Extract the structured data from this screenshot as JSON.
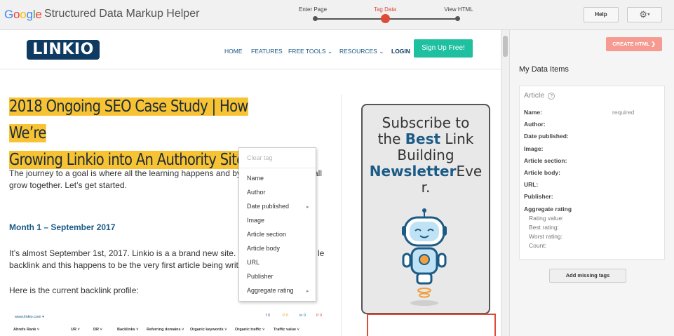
{
  "app": {
    "brand": "Google",
    "title": "Structured Data Markup Helper",
    "brand_colors": [
      "#4285f4",
      "#ea4335",
      "#fbbc05",
      "#4285f4",
      "#34a853",
      "#ea4335"
    ]
  },
  "steps": [
    {
      "label": "Enter Page",
      "active": false
    },
    {
      "label": "Tag Data",
      "active": true
    },
    {
      "label": "View HTML",
      "active": false
    }
  ],
  "toolbar": {
    "help_label": "Help",
    "gear_icon": "gear-icon",
    "caret": "▾"
  },
  "site": {
    "logo_text": "LINKIO",
    "nav": [
      {
        "label": "HOME"
      },
      {
        "label": "FEATURES"
      },
      {
        "label": "FREE TOOLS ⌄"
      },
      {
        "label": "RESOURCES ⌄"
      },
      {
        "label": "LOGIN"
      }
    ],
    "signup_label": "Sign Up Free!",
    "article": {
      "title_line1": "2018 Ongoing SEO Case Study | How We’re",
      "title_line2": "Growing Linkio into An Authority Site",
      "intro_line1": "The journey to a goal is where all the learning happens and by sh",
      "intro_line1b": "all",
      "intro_line2": "grow together. Let’s get started.",
      "month_heading": "Month 1 – September 2017",
      "para2_line1": "It’s almost September 1st, 2017. Linkio is a a brand new site. It do",
      "para2_line1b": "le",
      "para2_line2": "backlink and this happens to be the very first article being writter",
      "para3": "Here is the current backlink profile:"
    },
    "table_preview": {
      "url": "www.linkio.com ▾",
      "social": [
        "f 0",
        "P 0",
        "in 0",
        "P 0"
      ],
      "headers": [
        "Ahrefs Rank ˅",
        "UR ˅",
        "DR ˅",
        "Backlinks ˅",
        "Referring domains ˅",
        "Organic keywords ˅",
        "Organic traffic ˅",
        "Traffic value ˅"
      ]
    },
    "sidebar": {
      "line1": "Subscribe to",
      "line2a": "the ",
      "line2b": "Best",
      "line2c": " Link",
      "line3": "Building",
      "line4a": "Newsletter",
      "line4b": "Eve",
      "line5": "r."
    }
  },
  "context_menu": {
    "clear_label": "Clear tag",
    "items": [
      {
        "label": "Name",
        "submenu": false
      },
      {
        "label": "Author",
        "submenu": false
      },
      {
        "label": "Date published",
        "submenu": true
      },
      {
        "label": "Image",
        "submenu": false
      },
      {
        "label": "Article section",
        "submenu": false
      },
      {
        "label": "Article body",
        "submenu": false
      },
      {
        "label": "URL",
        "submenu": false
      },
      {
        "label": "Publisher",
        "submenu": false
      },
      {
        "label": "Aggregate rating",
        "submenu": true
      }
    ],
    "arrow": "▸"
  },
  "panel": {
    "create_html_label": "CREATE HTML",
    "create_html_arrow": "❯",
    "my_data_title": "My Data Items",
    "card_title": "Article",
    "help_glyph": "?",
    "required_text": "required",
    "fields": [
      "Name:",
      "Author:",
      "Date published:",
      "Image:",
      "Article section:",
      "Article body:",
      "URL:",
      "Publisher:",
      "Aggregate rating"
    ],
    "subfields": [
      "Rating value:",
      "Best rating:",
      "Worst rating:",
      "Count:"
    ],
    "add_missing_label": "Add missing tags"
  }
}
